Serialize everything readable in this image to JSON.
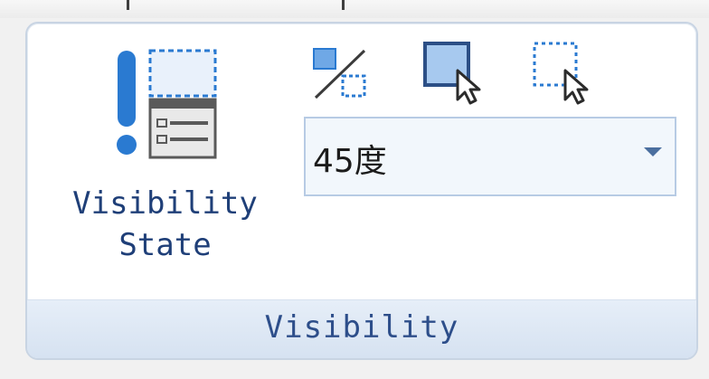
{
  "group": {
    "label": "Visibility"
  },
  "visibility_state": {
    "label_line1": "Visibility",
    "label_line2": "State",
    "icon": "visibility-state-icon"
  },
  "tools": [
    {
      "icon": "diagonal-divider-icon"
    },
    {
      "icon": "select-solid-box-icon"
    },
    {
      "icon": "select-dotted-box-icon"
    }
  ],
  "angle_dropdown": {
    "value": "45度"
  },
  "colors": {
    "accent_blue": "#1f3f78",
    "panel_border": "#c8d4e3",
    "footer_bg": "#d6e2f1",
    "icon_blue": "#2a7ad1"
  }
}
